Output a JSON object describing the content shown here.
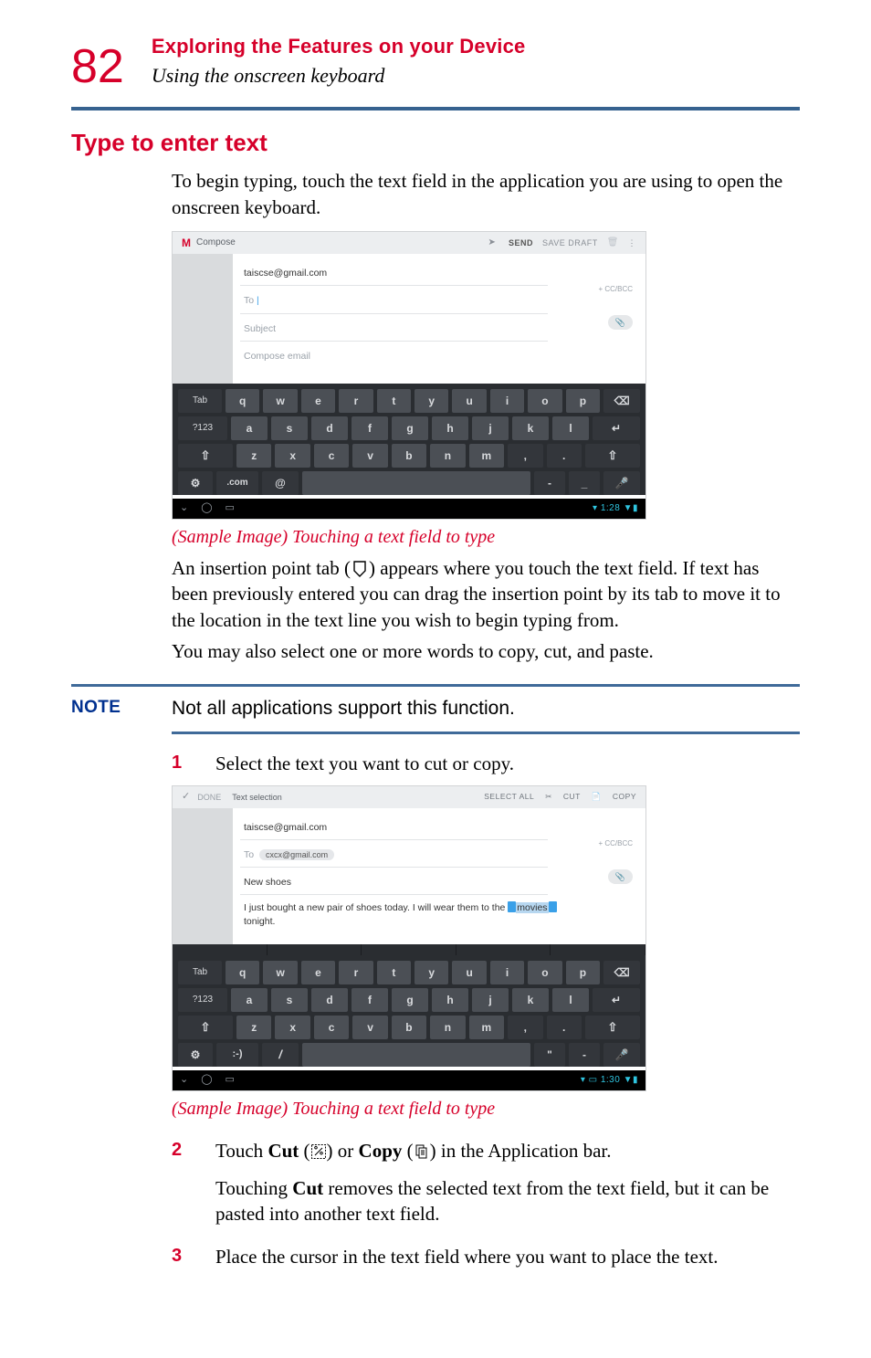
{
  "header": {
    "page_number": "82",
    "chapter": "Exploring the Features on your Device",
    "section": "Using the onscreen keyboard"
  },
  "h2": "Type to enter text",
  "intro": "To begin typing, touch the text field in the application you are using to open the onscreen keyboard.",
  "compose1": {
    "title": "Compose",
    "send": "SEND",
    "save_draft": "SAVE DRAFT",
    "from": "taiscse@gmail.com",
    "to_label": "To",
    "ccbcc": "+ CC/BCC",
    "subject_ph": "Subject",
    "body_ph": "Compose email",
    "clock": "1:28"
  },
  "keyboard": {
    "row1": [
      "q",
      "w",
      "e",
      "r",
      "t",
      "y",
      "u",
      "i",
      "o",
      "p"
    ],
    "row2": [
      "a",
      "s",
      "d",
      "f",
      "g",
      "h",
      "j",
      "k",
      "l"
    ],
    "row3": [
      "z",
      "x",
      "c",
      "v",
      "b",
      "n",
      "m"
    ],
    "tab": "Tab",
    "sym": "?123",
    "com": ".com",
    "at": "@",
    "smile": ":-)",
    "slash": "/"
  },
  "caption": "(Sample Image) Touching a text field to type",
  "para1a": "An insertion point tab (",
  "para1b": ") appears where you touch the text field. If text has been previously entered you can drag the insertion point by its tab to move it to the location in the text line you wish to begin typing from.",
  "para2": "You may also select one or more words to copy, cut, and paste.",
  "note": {
    "label": "NOTE",
    "text": "Not all applications support this function."
  },
  "steps": {
    "s1": {
      "num": "1",
      "text": "Select the text you want to cut or copy."
    },
    "s2": {
      "num": "2",
      "line_a": "Touch ",
      "cut": "Cut",
      "mid1": " (",
      "mid2": ") or ",
      "copy": "Copy",
      "mid3": " (",
      "mid4": ") in the Application bar.",
      "para": "Touching Cut removes the selected text from the text field, but it can be pasted into another text field.",
      "para_pre": "Touching ",
      "para_bold": "Cut",
      "para_post": " removes the selected text from the text field, but it can be pasted into another text field."
    },
    "s3": {
      "num": "3",
      "text": "Place the cursor in the text field where you want to place the text."
    }
  },
  "sel": {
    "done": "DONE",
    "title": "Text selection",
    "select_all": "SELECT ALL",
    "cut": "CUT",
    "copy": "COPY",
    "from": "taiscse@gmail.com",
    "to_label": "To",
    "to_chip": "cxcx@gmail.com",
    "ccbcc": "+ CC/BCC",
    "subject": "New shoes",
    "body_pre": "I just bought a new pair of shoes today.  I will wear them to the ",
    "body_sel": "movies",
    "body_post": " tonight.",
    "clock": "1:30"
  }
}
